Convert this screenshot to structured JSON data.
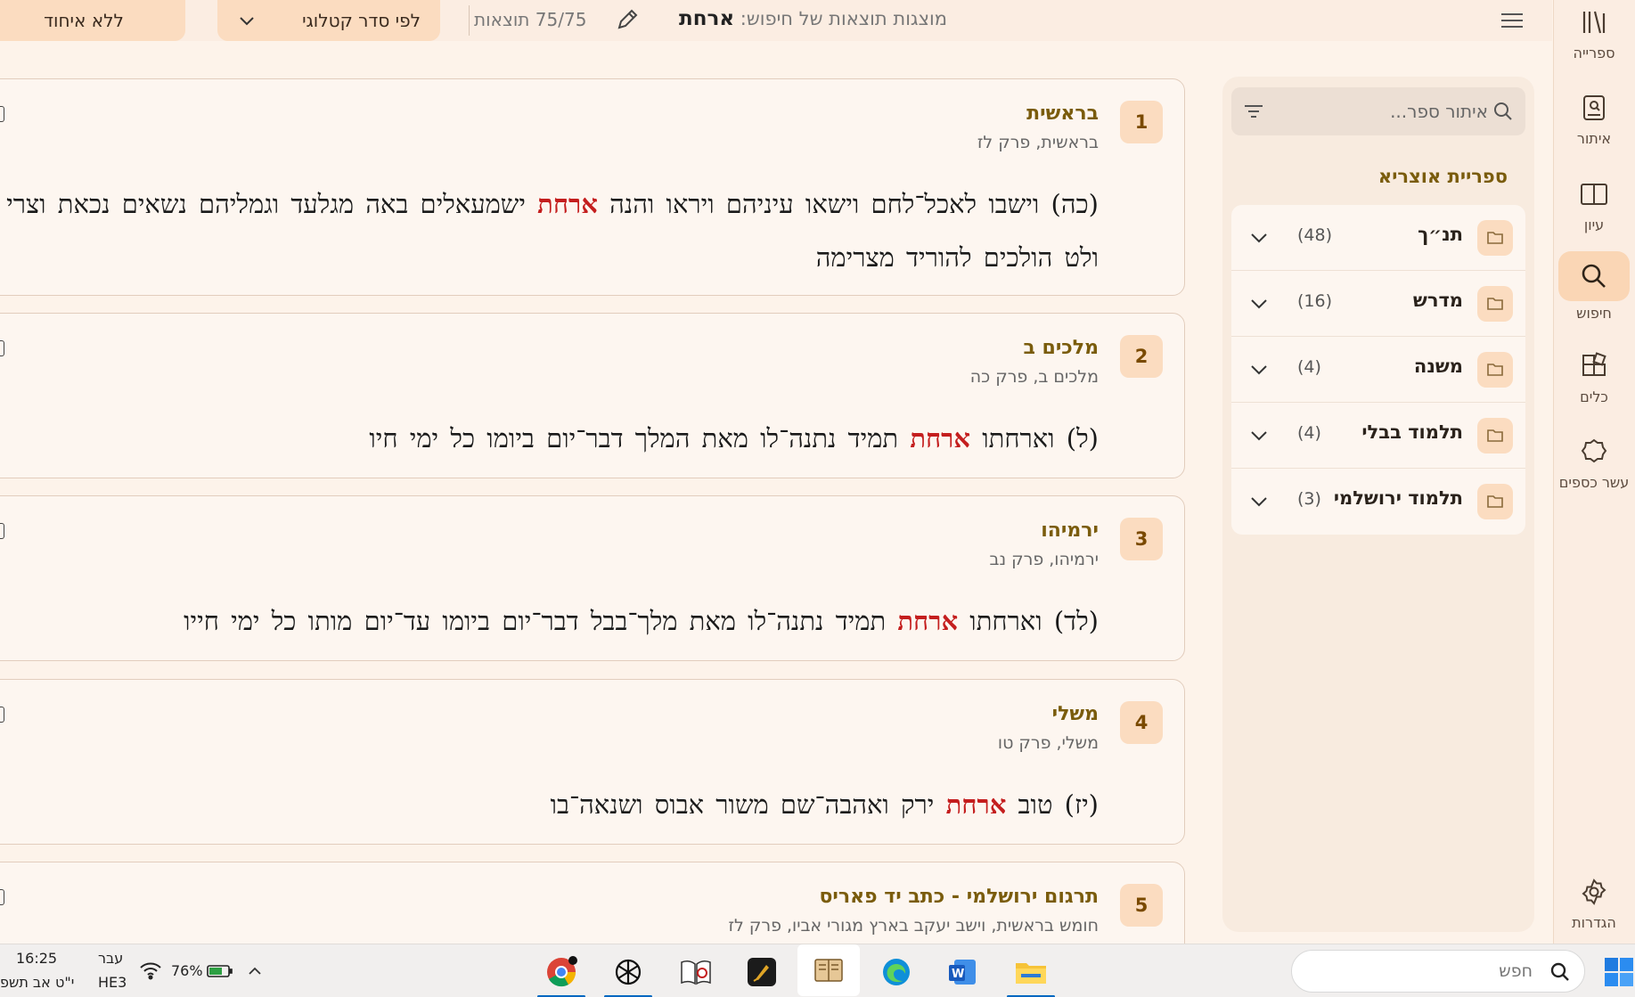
{
  "colors": {
    "accent": "#fbdcc0",
    "highlight": "#c41e1e",
    "book_title": "#7a5c0c",
    "background": "#fdf3ea"
  },
  "rail": {
    "items": [
      {
        "label": "ספרייה",
        "icon": "library-icon"
      },
      {
        "label": "איתור",
        "icon": "find-book-icon"
      },
      {
        "label": "עיון",
        "icon": "open-book-icon"
      },
      {
        "label": "חיפוש",
        "icon": "search-icon",
        "active": true
      },
      {
        "label": "כלים",
        "icon": "tools-icon"
      },
      {
        "label": "עשר כספים",
        "icon": "gear-badge-icon"
      }
    ],
    "settings_label": "הגדרות"
  },
  "topbar": {
    "search_prefix": "מוצגות תוצאות של חיפוש:",
    "query": "ארחת",
    "result_count": "75/75 תוצאות",
    "sort_label": "לפי סדר קטלוגי",
    "group_label": "ללא איחוד"
  },
  "filter": {
    "placeholder": "איתור ספר...",
    "library_title": "ספריית אוצריא",
    "categories": [
      {
        "name": "תנ״ך",
        "count": "(48)"
      },
      {
        "name": "מדרש",
        "count": "(16)"
      },
      {
        "name": "משנה",
        "count": "(4)"
      },
      {
        "name": "תלמוד בבלי",
        "count": "(4)"
      },
      {
        "name": "תלמוד ירושלמי",
        "count": "(3)"
      }
    ]
  },
  "results": [
    {
      "num": "1",
      "title": "בראשית",
      "ref": "בראשית, פרק לז",
      "before": "(כה) וישבו לאכל־לחם וישאו עיניהם ויראו והנה ",
      "match": "ארחת",
      "after": " ישמעאלים באה מגלעד וגמליהם נשאים נכאת וצרי ולט הולכים להוריד מצרימה"
    },
    {
      "num": "2",
      "title": "מלכים ב",
      "ref": "מלכים ב, פרק כה",
      "before": "(ל) וארחתו ",
      "match": "ארחת",
      "after": " תמיד נתנה־לו מאת המלך דבר־יום ביומו כל ימי חיו"
    },
    {
      "num": "3",
      "title": "ירמיהו",
      "ref": "ירמיהו, פרק נב",
      "before": "(לד) וארחתו ",
      "match": "ארחת",
      "after": " תמיד נתנה־לו מאת מלך־בבל דבר־יום ביומו עד־יום מותו כל ימי חייו"
    },
    {
      "num": "4",
      "title": "משלי",
      "ref": "משלי, פרק טו",
      "before": "(יז) טוב ",
      "match": "ארחת",
      "after": " ירק ואהבה־שם משור אבוס ושנאה־בו"
    },
    {
      "num": "5",
      "title": "תרגום ירושלמי - כתב יד פאריס",
      "ref": "חומש בראשית, וישב יעקב בארץ מגורי אביו, פרק לז",
      "before": "",
      "match": "",
      "after": ""
    }
  ],
  "taskbar": {
    "search_placeholder": "חפש",
    "battery": "76%",
    "lang_top": "עבר",
    "lang_bottom": "HE3",
    "time": "16:25",
    "date": "י\"ט אב תשפ"
  }
}
